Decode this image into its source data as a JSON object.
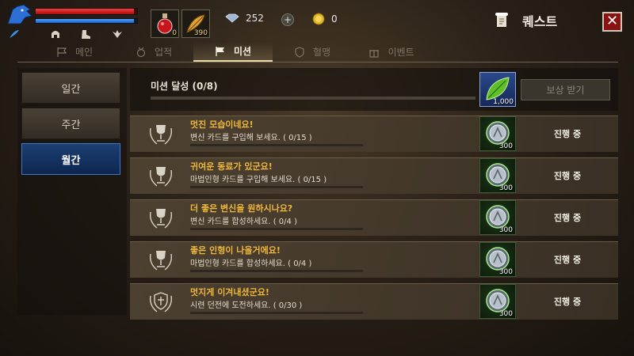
{
  "hud": {
    "hp_fraction": 0.97,
    "mp_fraction": 0.97,
    "potion_count": "0",
    "item_count": "390",
    "gems": "252",
    "gold": "0"
  },
  "window": {
    "title": "퀘스트"
  },
  "tabs": [
    {
      "label": "메인",
      "icon": "flag-outline-icon"
    },
    {
      "label": "업적",
      "icon": "medal-icon"
    },
    {
      "label": "미션",
      "icon": "flag-icon"
    },
    {
      "label": "혈맹",
      "icon": "shield-icon"
    },
    {
      "label": "이벤트",
      "icon": "gift-icon"
    }
  ],
  "sidebar": {
    "items": [
      "일간",
      "주간",
      "월간"
    ]
  },
  "summary": {
    "title": "미션 달성 (0/8)",
    "progress": 0,
    "reward_count": "1,000",
    "claim_label": "보상 받기"
  },
  "missions": [
    {
      "title": "멋진 모습이네요!",
      "desc": "변신 카드를 구입해 보세요. ( 0/15 )",
      "progress": 0,
      "reward": "300",
      "status": "진행 중"
    },
    {
      "title": "귀여운 동료가 있군요!",
      "desc": "마법인형 카드를 구입해 보세요. ( 0/15 )",
      "progress": 0,
      "reward": "300",
      "status": "진행 중"
    },
    {
      "title": "더 좋은 변신을 원하시나요?",
      "desc": "변신 카드를 합성하세요. ( 0/4 )",
      "progress": 0,
      "reward": "300",
      "status": "진행 중"
    },
    {
      "title": "좋은 인형이 나올거에요!",
      "desc": "마법인형 카드를 합성하세요. ( 0/4 )",
      "progress": 0,
      "reward": "300",
      "status": "진행 중"
    },
    {
      "title": "멋지게 이겨내셨군요!",
      "desc": "시련 던전에 도전하세요. ( 0/30 )",
      "progress": 0,
      "reward": "300",
      "status": "진행 중"
    }
  ],
  "colors": {
    "accent_gold": "#f0b73a",
    "active_blue": "#1c3f72",
    "close_red": "#8a1212"
  }
}
